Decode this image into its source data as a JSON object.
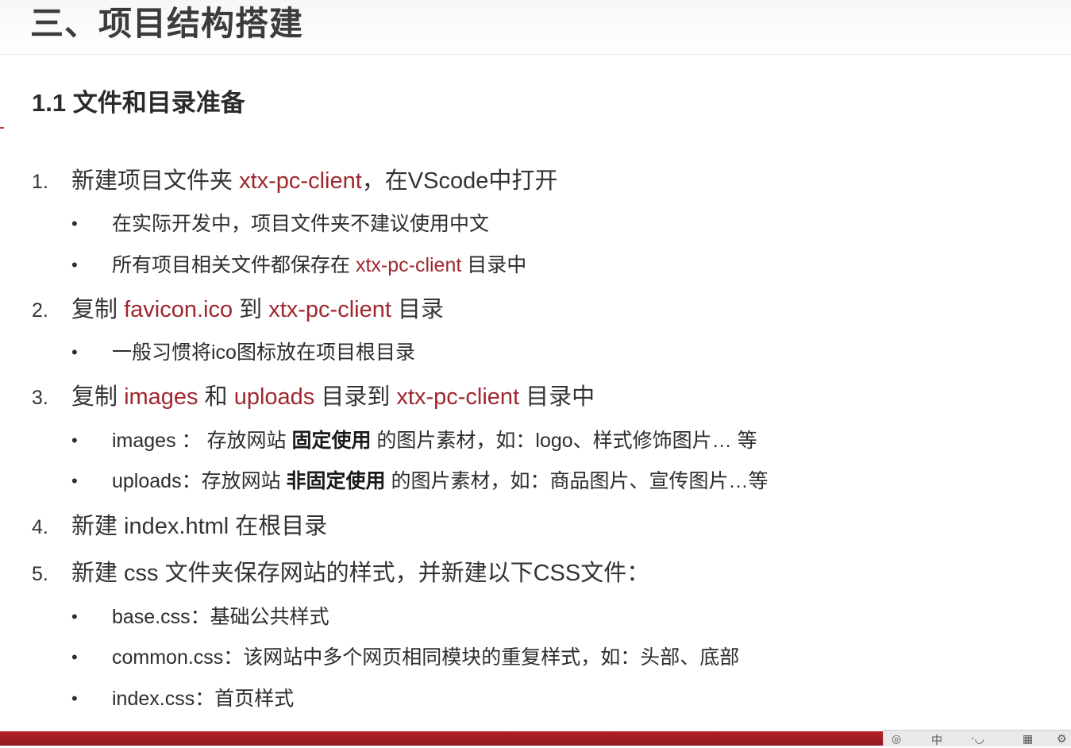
{
  "slide": {
    "title": "三、项目结构搭建",
    "section": "1.1 文件和目录准备"
  },
  "items": [
    {
      "num": "1.",
      "parts": [
        "新建项目文件夹 ",
        "xtx-pc-client",
        "，在VScode中打开"
      ],
      "bullets": [
        {
          "parts": [
            "在实际开发中，项目文件夹不建议使用中文"
          ]
        },
        {
          "parts": [
            "所有项目相关文件都保存在 ",
            "xtx-pc-client",
            " 目录中"
          ]
        }
      ]
    },
    {
      "num": "2.",
      "parts": [
        "复制 ",
        "favicon.ico",
        " 到 ",
        "xtx-pc-client",
        " 目录"
      ],
      "bullets": [
        {
          "parts": [
            "一般习惯将ico图标放在项目根目录"
          ]
        }
      ]
    },
    {
      "num": "3.",
      "parts": [
        "复制 ",
        "images",
        " 和 ",
        "uploads",
        " 目录到 ",
        "xtx-pc-client",
        " 目录中"
      ],
      "bullets": [
        {
          "parts": [
            "images ： 存放网站 ",
            "固定使用",
            " 的图片素材，如：logo、样式修饰图片… 等"
          ]
        },
        {
          "parts": [
            "uploads：存放网站 ",
            "非固定使用",
            " 的图片素材，如：商品图片、宣传图片…等"
          ]
        }
      ]
    },
    {
      "num": "4.",
      "parts": [
        "新建 index.html 在根目录"
      ],
      "bullets": []
    },
    {
      "num": "5.",
      "parts": [
        "新建 css 文件夹保存网站的样式，并新建以下CSS文件："
      ],
      "bullets": [
        {
          "parts": [
            "base.css：基础公共样式"
          ]
        },
        {
          "parts": [
            "common.css：该网站中多个网页相同模块的重复样式，如：头部、底部"
          ]
        },
        {
          "parts": [
            "index.css：首页样式"
          ]
        }
      ]
    }
  ],
  "bullet_char": "•",
  "player": {
    "icons": [
      "player-logo-icon",
      "chinese-input-icon",
      "punctuation-icon",
      "keyboard-icon",
      "settings-icon"
    ]
  },
  "colors": {
    "highlight": "#a0272e",
    "footer": "#b52026"
  }
}
